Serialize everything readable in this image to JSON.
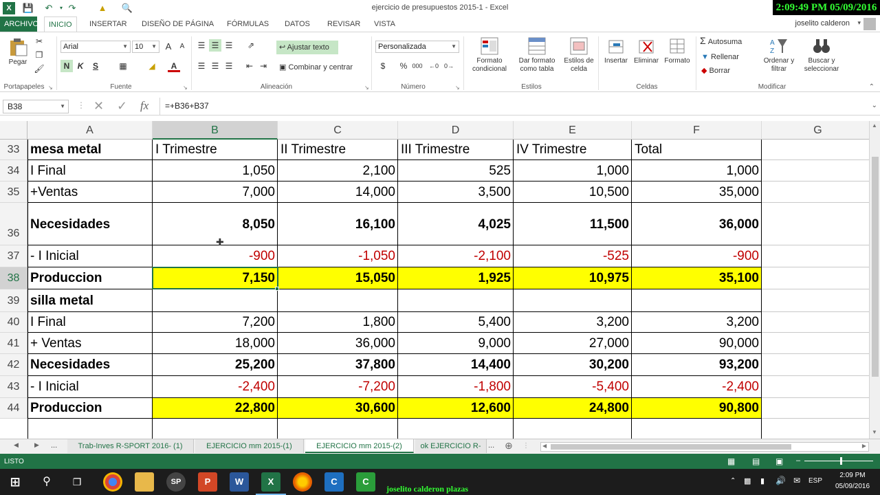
{
  "titlebar": {
    "title": "ejercicio de presupuestos 2015-1 - Excel",
    "clock": "2:09:49 PM 05/09/2016"
  },
  "tabs": {
    "file": "ARCHIVO",
    "items": [
      "INICIO",
      "INSERTAR",
      "DISEÑO DE PÁGINA",
      "FÓRMULAS",
      "DATOS",
      "REVISAR",
      "VISTA"
    ],
    "user": "joselito calderon"
  },
  "ribbon": {
    "paste": "Pegar",
    "font_name": "Arial",
    "font_size": "10",
    "bold": "N",
    "italic": "K",
    "underline": "S",
    "wrap_text": "Ajustar texto",
    "merge": "Combinar y centrar",
    "number_format": "Personalizada",
    "currency": "$",
    "percent": "%",
    "thousands": "000",
    "cond_format": "Formato condicional",
    "table_format": "Dar formato como tabla",
    "cell_styles": "Estilos de celda",
    "insert": "Insertar",
    "delete": "Eliminar",
    "format": "Formato",
    "autosum": "Autosuma",
    "fill": "Rellenar",
    "clear": "Borrar",
    "sort": "Ordenar y filtrar",
    "find": "Buscar y seleccionar",
    "groups": [
      "Portapapeles",
      "Fuente",
      "Alineación",
      "Número",
      "Estilos",
      "Celdas",
      "Modificar"
    ]
  },
  "formula_bar": {
    "name_box": "B38",
    "fx": "fx",
    "formula": "=+B36+B37"
  },
  "columns": [
    "A",
    "B",
    "C",
    "D",
    "E",
    "F",
    "G"
  ],
  "rows": [
    {
      "num": "33",
      "cells": [
        "mesa metal",
        "I  Trimestre",
        "II Trimestre",
        "III   Trimestre",
        "IV Trimestre",
        "Total"
      ]
    },
    {
      "num": "34",
      "cells": [
        "I Final",
        "1,050",
        "2,100",
        "525",
        "1,000",
        "1,000"
      ]
    },
    {
      "num": "35",
      "cells": [
        "+Ventas",
        "7,000",
        "14,000",
        "3,500",
        "10,500",
        "35,000"
      ]
    },
    {
      "num": "36",
      "cells": [
        "Necesidades",
        "8,050",
        "16,100",
        "4,025",
        "11,500",
        "36,000"
      ]
    },
    {
      "num": "37",
      "cells": [
        "- I Inicial",
        "-900",
        "-1,050",
        "-2,100",
        "-525",
        "-900"
      ]
    },
    {
      "num": "38",
      "cells": [
        "Produccion",
        "7,150",
        "15,050",
        "1,925",
        "10,975",
        "35,100"
      ]
    },
    {
      "num": "39",
      "cells": [
        "silla metal",
        "",
        "",
        "",
        "",
        ""
      ]
    },
    {
      "num": "40",
      "cells": [
        "I Final",
        "7,200",
        "1,800",
        "5,400",
        "3,200",
        "3,200"
      ]
    },
    {
      "num": "41",
      "cells": [
        "+ Ventas",
        "18,000",
        "36,000",
        "9,000",
        "27,000",
        "90,000"
      ]
    },
    {
      "num": "42",
      "cells": [
        "Necesidades",
        "25,200",
        "37,800",
        "14,400",
        "30,200",
        "93,200"
      ]
    },
    {
      "num": "43",
      "cells": [
        "- I Inicial",
        "-2,400",
        "-7,200",
        "-1,800",
        "-5,400",
        "-2,400"
      ]
    },
    {
      "num": "44",
      "cells": [
        "Produccion",
        "22,800",
        "30,600",
        "12,600",
        "24,800",
        "90,800"
      ]
    }
  ],
  "sheets": {
    "more_left": "...",
    "items": [
      "Trab-Inves R-SPORT 2016- (1)",
      "EJERCICIO mm 2015-(1)",
      "EJERCICIO mm 2015-(2)",
      "ok EJERCICIO R-"
    ],
    "more_right": "...",
    "active": "EJERCICIO mm 2015-(2)"
  },
  "status": {
    "text": "LISTO"
  },
  "taskbar": {
    "label": "joselito calderon plazas",
    "lang": "ESP",
    "time": "2:09 PM",
    "date": "05/09/2016"
  },
  "colors": {
    "accent": "#217346",
    "highlight": "#ffff00",
    "negative": "#c00000"
  }
}
